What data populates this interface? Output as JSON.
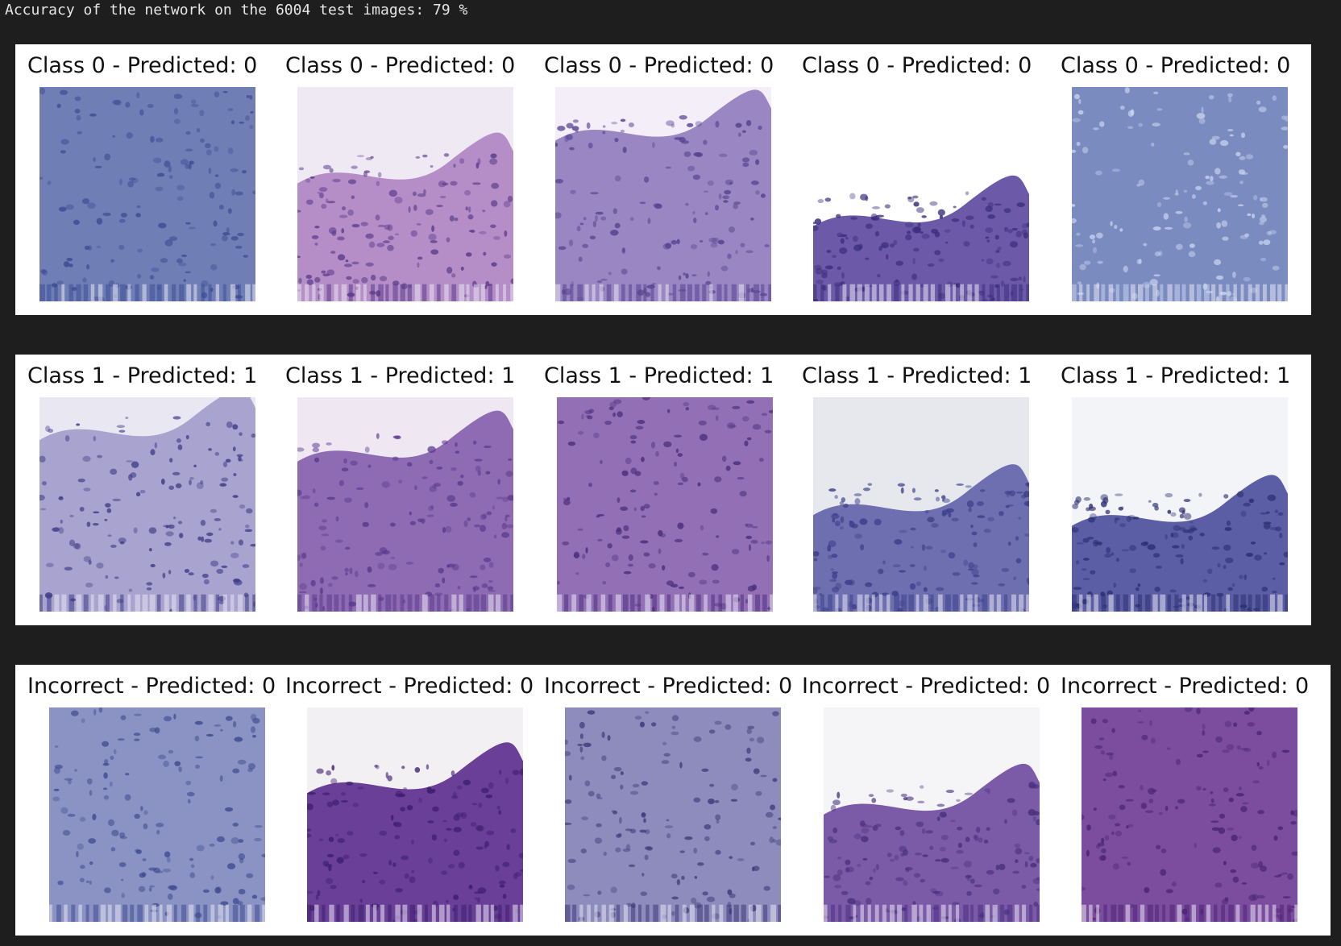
{
  "console": {
    "output_line": "Accuracy of the network on the 6004 test images: 79 %"
  },
  "figures": [
    {
      "name": "class-0-figure",
      "tiles": [
        {
          "title": "Class 0 - Predicted: 0",
          "texture": {
            "base": "#6f7fb6",
            "bg": "#6f7fb6",
            "dots": "#3d4c93",
            "blank": 0.0
          }
        },
        {
          "title": "Class 0 - Predicted: 0",
          "texture": {
            "base": "#b58ec8",
            "bg": "#efe9f4",
            "dots": "#5a3b8a",
            "blank": 0.35
          }
        },
        {
          "title": "Class 0 - Predicted: 0",
          "texture": {
            "base": "#9a86c2",
            "bg": "#f4eef8",
            "dots": "#55418f",
            "blank": 0.15
          }
        },
        {
          "title": "Class 0 - Predicted: 0",
          "texture": {
            "base": "#6c5aa8",
            "bg": "#ffffff",
            "dots": "#3b2d7d",
            "blank": 0.55
          }
        },
        {
          "title": "Class 0 - Predicted: 0",
          "texture": {
            "base": "#7a8bc0",
            "bg": "#7a8bc0",
            "dots": "#c9d3ee",
            "blank": 0.0
          }
        }
      ]
    },
    {
      "name": "class-1-figure",
      "tiles": [
        {
          "title": "Class 1 - Predicted: 1",
          "texture": {
            "base": "#a9a3cf",
            "bg": "#e9e8f2",
            "dots": "#3e3b86",
            "blank": 0.1
          }
        },
        {
          "title": "Class 1 - Predicted: 1",
          "texture": {
            "base": "#8e6bb2",
            "bg": "#efe8f3",
            "dots": "#5a3a8e",
            "blank": 0.2
          }
        },
        {
          "title": "Class 1 - Predicted: 1",
          "texture": {
            "base": "#9370b6",
            "bg": "#9370b6",
            "dots": "#4b2f7c",
            "blank": 0.0
          }
        },
        {
          "title": "Class 1 - Predicted: 1",
          "texture": {
            "base": "#6e6fb0",
            "bg": "#e6e8ee",
            "dots": "#3b3f8a",
            "blank": 0.45
          }
        },
        {
          "title": "Class 1 - Predicted: 1",
          "texture": {
            "base": "#5b5ea4",
            "bg": "#f3f4f7",
            "dots": "#2d2f72",
            "blank": 0.5
          }
        }
      ]
    },
    {
      "name": "incorrect-figure",
      "tiles": [
        {
          "title": "Incorrect - Predicted: 0",
          "texture": {
            "base": "#8a93c4",
            "bg": "#8a93c4",
            "dots": "#3f4b8f",
            "blank": 0.0
          }
        },
        {
          "title": "Incorrect - Predicted: 0",
          "texture": {
            "base": "#6a3f98",
            "bg": "#f3f0f3",
            "dots": "#3d1f6e",
            "blank": 0.3
          }
        },
        {
          "title": "Incorrect - Predicted: 0",
          "texture": {
            "base": "#8e8bbd",
            "bg": "#8e8bbd",
            "dots": "#3c3978",
            "blank": 0.0
          }
        },
        {
          "title": "Incorrect - Predicted: 0",
          "texture": {
            "base": "#7b5aa8",
            "bg": "#f5f5f7",
            "dots": "#48307f",
            "blank": 0.4
          }
        },
        {
          "title": "Incorrect - Predicted: 0",
          "texture": {
            "base": "#7c4d9f",
            "bg": "#e8e0ee",
            "dots": "#4a2474",
            "blank": 0.0
          }
        }
      ]
    }
  ]
}
